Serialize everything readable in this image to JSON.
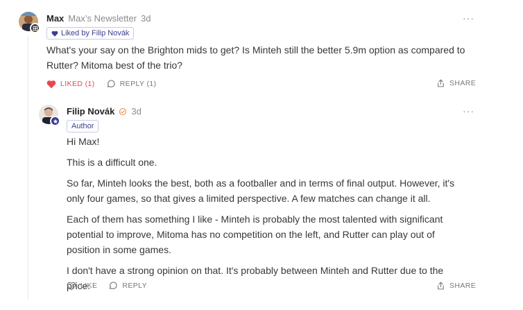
{
  "comment": {
    "author": "Max",
    "publication": "Max’s Newsletter",
    "time": "3d",
    "liked_by": "Liked by Filip Novák",
    "text": "What's your say on the Brighton mids to get? Is Minteh still the better 5.9m option as compared to Rutter? Mitoma best of the trio?",
    "like_label": "LIKED (1)",
    "reply_label": "REPLY (1)",
    "share_label": "SHARE",
    "more_icon": "ellipsis-icon"
  },
  "reply": {
    "author": "Filip Novák",
    "time": "3d",
    "role_badge": "Author",
    "paragraphs": [
      "Hi Max!",
      "This is a difficult one.",
      "So far, Minteh looks the best, both as a footballer and in terms of final output. However, it's only four games, so that gives a limited perspective. A few matches can change it all.",
      "Each of them has something I like - Minteh is probably the most talented with significant potential to improve, Mitoma has no competition on the left, and Rutter can play out of position in some games.",
      "I don't have a strong opinion on that. It's probably between Minteh and Rutter due to the price."
    ],
    "like_label": "LIKE",
    "reply_label": "REPLY",
    "share_label": "SHARE"
  },
  "colors": {
    "liked": "#e5484d",
    "badge_border": "#c7c9e8",
    "badge_text": "#3a3f8f",
    "verified": "#e8833a"
  }
}
